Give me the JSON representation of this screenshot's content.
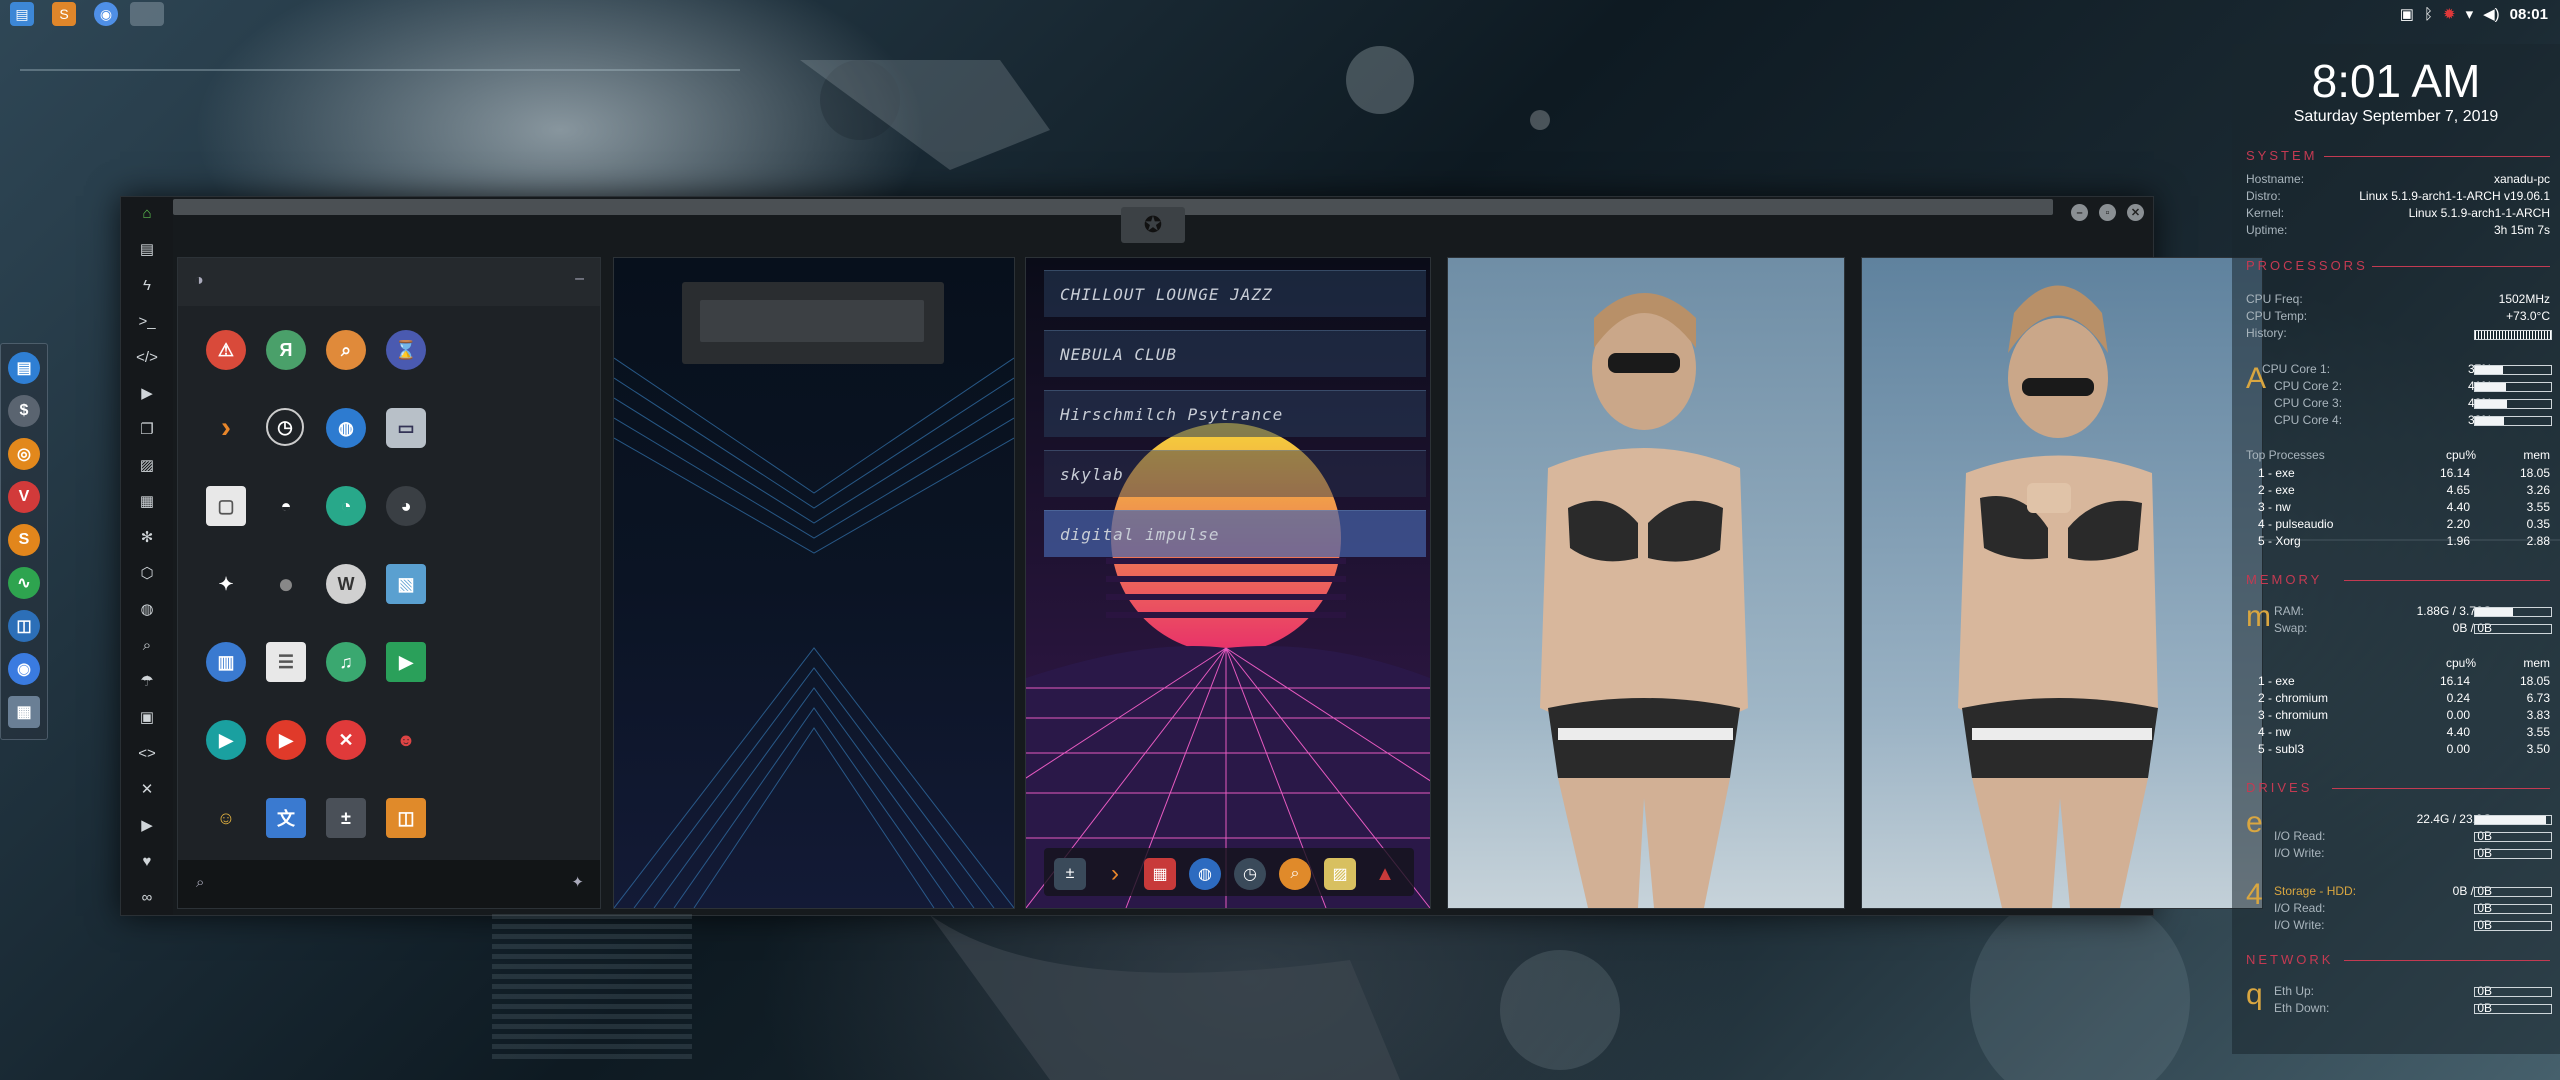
{
  "topbar": {
    "apps": [
      {
        "icon": "files-icon",
        "color": "#3d87d6"
      },
      {
        "icon": "sublime-icon",
        "color": "#e0862a"
      },
      {
        "icon": "chromium-icon",
        "color": "#4f8fe6"
      },
      {
        "icon": "window-thumbnail-icon",
        "color": "#8a9aa5"
      }
    ],
    "tray_icons": [
      "screenshot-icon",
      "bluetooth-icon",
      "settings-alert-icon",
      "wifi-icon",
      "volume-icon"
    ],
    "time": "08:01"
  },
  "dock": {
    "items": [
      {
        "icon": "files-icon",
        "color": "#2f7fd4",
        "glyph": "▤"
      },
      {
        "icon": "money-icon",
        "color": "#5a6470",
        "glyph": "$"
      },
      {
        "icon": "ubuntu-icon",
        "color": "#e2881c",
        "glyph": "◎"
      },
      {
        "icon": "vivaldi-icon",
        "color": "#d23a3a",
        "glyph": "V"
      },
      {
        "icon": "sublime-icon",
        "color": "#e2861c",
        "glyph": "S"
      },
      {
        "icon": "system-monitor-icon",
        "color": "#2ea44f",
        "glyph": "∿"
      },
      {
        "icon": "screenshot-tool-icon",
        "color": "#2c6fb8",
        "glyph": "◫"
      },
      {
        "icon": "chromium-icon",
        "color": "#3a7be0",
        "glyph": "◉"
      },
      {
        "icon": "workspace-icon",
        "color": "#6a7f95",
        "glyph": "▦"
      }
    ]
  },
  "window": {
    "left_nav": [
      "home-icon",
      "document-icon",
      "lightning-icon",
      "terminal-icon",
      "code-icon",
      "play-icon",
      "copy-icon",
      "image-icon",
      "newspaper-icon",
      "atom-icon",
      "hexagon-icon",
      "globe-icon",
      "search-icon",
      "umbrella-icon",
      "contact-icon",
      "code-brackets-icon",
      "expand-icon",
      "youtube-icon",
      "heart-icon",
      "infinity-icon"
    ],
    "launcher": {
      "header_icon": "theme-icon",
      "collapse_label": "–",
      "rows": [
        [
          {
            "icon": "warning-icon",
            "color": "#d94a3a",
            "glyph": "⚠"
          },
          {
            "icon": "yandex-icon",
            "color": "#4aa06a",
            "glyph": "Я"
          },
          {
            "icon": "search-app-icon",
            "color": "#e08a3a",
            "glyph": "⌕"
          },
          {
            "icon": "hourglass-icon",
            "color": "#4a5ab0",
            "glyph": "⌛"
          }
        ],
        [
          {
            "icon": "prompt-icon",
            "color": "#1e2226",
            "glyph": "›"
          },
          {
            "icon": "clock-icon",
            "color": "#1e2226",
            "glyph": "◷"
          },
          {
            "icon": "globe-app-icon",
            "color": "#2d7bd0",
            "glyph": "◍"
          },
          {
            "icon": "drive-icon",
            "color": "#b8c0c8",
            "glyph": "▭"
          }
        ],
        [
          {
            "icon": "window-app-icon",
            "color": "#e8e8e8",
            "glyph": "▢"
          },
          {
            "icon": "helmet-icon",
            "color": "#1e2226",
            "glyph": "◓"
          },
          {
            "icon": "vpn-icon",
            "color": "#28a88a",
            "glyph": "◔"
          },
          {
            "icon": "github-icon",
            "color": "#3a3f44",
            "glyph": "◕"
          }
        ],
        [
          {
            "icon": "starfleet-icon",
            "color": "#1e2226",
            "glyph": "✦"
          },
          {
            "icon": "death-star-icon",
            "color": "#1e2226",
            "glyph": "●"
          },
          {
            "icon": "wikipedia-icon",
            "color": "#d0d0d0",
            "glyph": "W"
          },
          {
            "icon": "maps-icon",
            "color": "#5aa0d0",
            "glyph": "▧"
          }
        ],
        [
          {
            "icon": "books-icon",
            "color": "#3a7ad0",
            "glyph": "▥"
          },
          {
            "icon": "document-app-icon",
            "color": "#e8e8e8",
            "glyph": "☰"
          },
          {
            "icon": "music-icon",
            "color": "#3aa870",
            "glyph": "♫"
          },
          {
            "icon": "video-icon",
            "color": "#2aa05a",
            "glyph": "▶"
          }
        ],
        [
          {
            "icon": "play-store-icon",
            "color": "#1aa0a0",
            "glyph": "▶"
          },
          {
            "icon": "youtube-app-icon",
            "color": "#e03a2a",
            "glyph": "▶"
          },
          {
            "icon": "close-app-icon",
            "color": "#e03a3a",
            "glyph": "✕"
          },
          {
            "icon": "iron-man-icon",
            "color": "#1e2226",
            "glyph": "☻"
          }
        ],
        [
          {
            "icon": "c3po-icon",
            "color": "#1e2226",
            "glyph": "☺"
          },
          {
            "icon": "translate-icon",
            "color": "#3a7ad0",
            "glyph": "文"
          },
          {
            "icon": "calculator-icon",
            "color": "#4a5058",
            "glyph": "±"
          },
          {
            "icon": "photos-icon",
            "color": "#e08a2a",
            "glyph": "◫"
          }
        ]
      ]
    },
    "radio": {
      "stations": [
        "CHILLOUT LOUNGE JAZZ",
        "NEBULA CLUB",
        "Hirschmilch Psytrance",
        "skylab",
        "digital impulse"
      ],
      "dock": [
        {
          "icon": "calculator-icon",
          "color": "#3a4a5a"
        },
        {
          "icon": "prompt-icon",
          "color": "#2a2a30"
        },
        {
          "icon": "calendar-icon",
          "color": "#c83a3a"
        },
        {
          "icon": "globe-icon",
          "color": "#2d6bc0"
        },
        {
          "icon": "clock-icon",
          "color": "#3a4a5a"
        },
        {
          "icon": "search-icon",
          "color": "#e08a2a"
        },
        {
          "icon": "image-icon",
          "color": "#d8c060"
        },
        {
          "icon": "arch-icon",
          "color": "#c83a3a"
        }
      ]
    }
  },
  "conky": {
    "time": "8:01 AM",
    "date": "Saturday September  7, 2019",
    "system": {
      "title": "SYSTEM",
      "rows": [
        {
          "k": "Hostname:",
          "v": "xanadu-pc"
        },
        {
          "k": "Distro:",
          "v": "Linux 5.1.9-arch1-1-ARCH v19.06.1"
        },
        {
          "k": "Kernel:",
          "v": "Linux 5.1.9-arch1-1-ARCH"
        },
        {
          "k": "Uptime:",
          "v": "3h 15m 7s"
        }
      ]
    },
    "processors": {
      "title": "PROCESSORS",
      "freq_label": "CPU Freq:",
      "freq": "1502MHz",
      "temp_label": "CPU Temp:",
      "temp": "+73.0°C",
      "history_label": "History:",
      "glyph": "A",
      "cores": [
        {
          "label": "CPU Core 1:",
          "value": "37%",
          "pct": 37
        },
        {
          "label": "CPU Core 2:",
          "value": "41%",
          "pct": 41
        },
        {
          "label": "CPU Core 3:",
          "value": "42%",
          "pct": 42
        },
        {
          "label": "CPU Core 4:",
          "value": "38%",
          "pct": 38
        }
      ],
      "top_title": "Top Processes",
      "col_cpu": "cpu%",
      "col_mem": "mem",
      "procs": [
        {
          "name": "1 - exe",
          "cpu": "16.14",
          "mem": "18.05"
        },
        {
          "name": "2 - exe",
          "cpu": "4.65",
          "mem": "3.26"
        },
        {
          "name": "3 - nw",
          "cpu": "4.40",
          "mem": "3.55"
        },
        {
          "name": "4 - pulseaudio",
          "cpu": "2.20",
          "mem": "0.35"
        },
        {
          "name": "5 - Xorg",
          "cpu": "1.96",
          "mem": "2.88"
        }
      ]
    },
    "memory": {
      "title": "MEMORY",
      "glyph": "m",
      "ram_label": "RAM:",
      "ram": "1.88G / 3.76G",
      "ram_pct": 50,
      "swap_label": "Swap:",
      "swap": "0B / 0B",
      "swap_pct": 0,
      "col_cpu": "cpu%",
      "col_mem": "mem",
      "procs": [
        {
          "name": "1 - exe",
          "cpu": "16.14",
          "mem": "18.05"
        },
        {
          "name": "2 - chromium",
          "cpu": "0.24",
          "mem": "6.73"
        },
        {
          "name": "3 - chromium",
          "cpu": "0.00",
          "mem": "3.83"
        },
        {
          "name": "4 - nw",
          "cpu": "4.40",
          "mem": "3.55"
        },
        {
          "name": "5 - subl3",
          "cpu": "0.00",
          "mem": "3.50"
        }
      ]
    },
    "drives": {
      "title": "DRIVES",
      "glyph1": "e",
      "d1_value": "22.4G / 23.9G",
      "d1_pct": 94,
      "io_read_label": "I/O Read:",
      "io_read": "0B",
      "io_write_label": "I/O Write:",
      "io_write": "0B",
      "glyph2": "4",
      "d2_label": "Storage - HDD:",
      "d2_value": "0B / 0B",
      "d2_read": "0B",
      "d2_write": "0B"
    },
    "network": {
      "title": "NETWORK",
      "glyph": "q",
      "up_label": "Eth Up:",
      "up": "0B",
      "down_label": "Eth Down:",
      "down": "0B"
    }
  }
}
